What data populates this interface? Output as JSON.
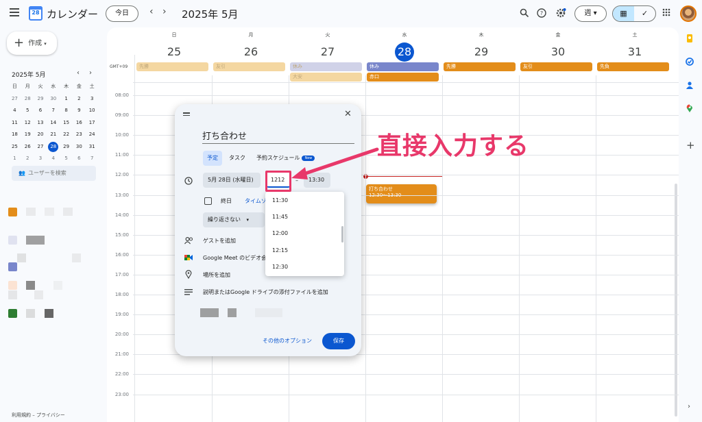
{
  "header": {
    "app_title": "カレンダー",
    "logo_day": "28",
    "today": "今日",
    "prev": "‹",
    "next": "›",
    "month": "2025年 5月",
    "view": "週 ▾",
    "calendar_toggle": "▦",
    "tasks_toggle": "✓"
  },
  "sidebar": {
    "create": "作成",
    "mini_month": "2025年 5月",
    "mini_prev": "‹",
    "mini_next": "›",
    "weekdays": [
      "日",
      "月",
      "火",
      "水",
      "木",
      "金",
      "土"
    ],
    "weeks": [
      [
        "27",
        "28",
        "29",
        "30",
        "1",
        "2",
        "3"
      ],
      [
        "4",
        "5",
        "6",
        "7",
        "8",
        "9",
        "10"
      ],
      [
        "11",
        "12",
        "13",
        "14",
        "15",
        "16",
        "17"
      ],
      [
        "18",
        "19",
        "20",
        "21",
        "22",
        "23",
        "24"
      ],
      [
        "25",
        "26",
        "27",
        "28",
        "29",
        "30",
        "31"
      ],
      [
        "1",
        "2",
        "3",
        "4",
        "5",
        "6",
        "7"
      ]
    ],
    "user_search": "ユーザーを検索",
    "footer": "利用規約 – プライバシー"
  },
  "calendar": {
    "timezone": "GMT+09",
    "days": [
      {
        "dow": "日",
        "num": "25"
      },
      {
        "dow": "月",
        "num": "26"
      },
      {
        "dow": "火",
        "num": "27"
      },
      {
        "dow": "水",
        "num": "28"
      },
      {
        "dow": "木",
        "num": "29"
      },
      {
        "dow": "金",
        "num": "30"
      },
      {
        "dow": "土",
        "num": "31"
      }
    ],
    "all_day_events": [
      {
        "day": 0,
        "label": "先勝",
        "color": "#f4d7a1",
        "faded": true,
        "row": 0
      },
      {
        "day": 1,
        "label": "友引",
        "color": "#f4d7a1",
        "faded": true,
        "row": 0
      },
      {
        "day": 2,
        "label": "休み",
        "color": "#d0d2e8",
        "faded": true,
        "row": 0
      },
      {
        "day": 2,
        "label": "大安",
        "color": "#f4d7a1",
        "faded": true,
        "row": 1
      },
      {
        "day": 3,
        "label": "休み",
        "color": "#7986cb",
        "faded": false,
        "row": 0
      },
      {
        "day": 3,
        "label": "赤口",
        "color": "#e38d1a",
        "faded": false,
        "row": 1
      },
      {
        "day": 4,
        "label": "先勝",
        "color": "#e38d1a",
        "faded": false,
        "row": 0
      },
      {
        "day": 5,
        "label": "友引",
        "color": "#e38d1a",
        "faded": false,
        "row": 0
      },
      {
        "day": 6,
        "label": "先負",
        "color": "#e38d1a",
        "faded": false,
        "row": 0
      }
    ],
    "times": [
      "08:00",
      "09:00",
      "10:00",
      "11:00",
      "12:00",
      "13:00",
      "14:00",
      "15:00",
      "16:00",
      "17:00",
      "18:00",
      "19:00",
      "20:00",
      "21:00",
      "22:00",
      "23:00"
    ],
    "event": {
      "title": "打ち合わせ",
      "time": "12:30～13:30"
    }
  },
  "dialog": {
    "title": "打ち合わせ",
    "tabs": [
      "予定",
      "タスク",
      "予約スケジュール"
    ],
    "new_badge": "New",
    "date": "5月 28日 (水曜日)",
    "start_time": "1212",
    "separator": "–",
    "end_time": "13:30",
    "all_day": "終日",
    "timezone_link": "タイムゾ",
    "repeat": "繰り返さない",
    "add_guests": "ゲストを追加",
    "meet": "Google Meet のビデオ会",
    "add_location": "場所を追加",
    "add_description": "説明またはGoogle ドライブの添付ファイルを追加",
    "more_options": "その他のオプション",
    "save": "保存"
  },
  "dropdown": {
    "options": [
      "11:30",
      "11:45",
      "12:00",
      "12:15",
      "12:30"
    ]
  },
  "annotation": {
    "text": "直接入力する",
    "color": "#e8386a"
  }
}
